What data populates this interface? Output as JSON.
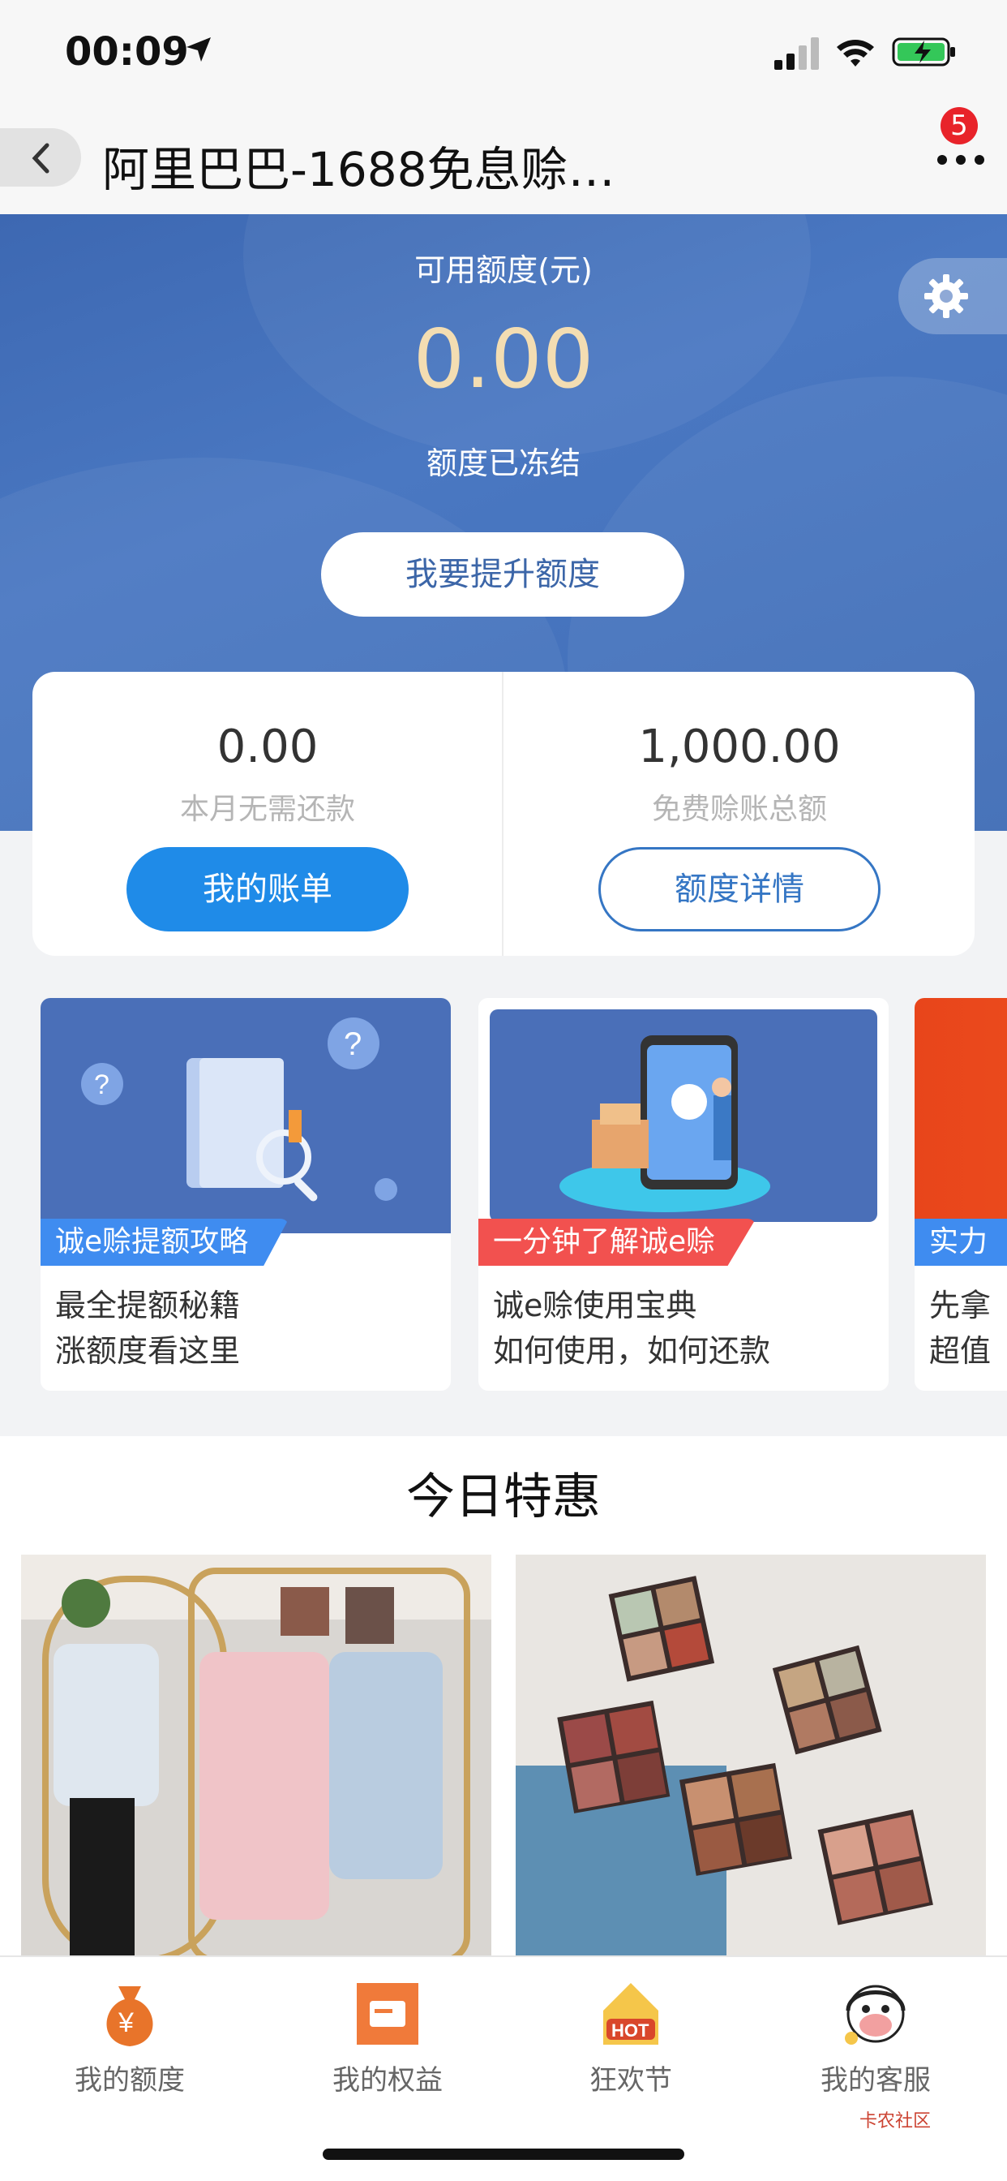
{
  "status_bar": {
    "time": "00:09"
  },
  "nav": {
    "title": "阿里巴巴-1688免息赊…",
    "badge": "5"
  },
  "credit": {
    "label": "可用额度(元)",
    "amount": "0.00",
    "status": "额度已冻结",
    "raise_button": "我要提升额度"
  },
  "summary": {
    "left": {
      "value": "0.00",
      "label": "本月无需还款",
      "button": "我的账单"
    },
    "right": {
      "value": "1,000.00",
      "label": "免费赊账总额",
      "button": "额度详情"
    }
  },
  "promos": [
    {
      "tag": "诚e赊提额攻略",
      "tag_color": "#3f8cf0",
      "line1": "最全提额秘籍",
      "line2": "涨额度看这里"
    },
    {
      "tag": "一分钟了解诚e赊",
      "tag_color": "#f2514f",
      "line1": "诚e赊使用宝典",
      "line2": "如何使用，如何还款"
    },
    {
      "tag": "实力",
      "tag_color": "#3f8cf0",
      "line1": "先拿",
      "line2": "超值"
    }
  ],
  "deals": {
    "heading": "今日特惠"
  },
  "tabs": [
    {
      "label": "我的额度",
      "icon": "money-bag-icon"
    },
    {
      "label": "我的权益",
      "icon": "coupon-icon"
    },
    {
      "label": "狂欢节",
      "icon": "hot-icon"
    },
    {
      "label": "我的客服",
      "icon": "customer-service-icon"
    }
  ],
  "watermark": "卡农社区"
}
